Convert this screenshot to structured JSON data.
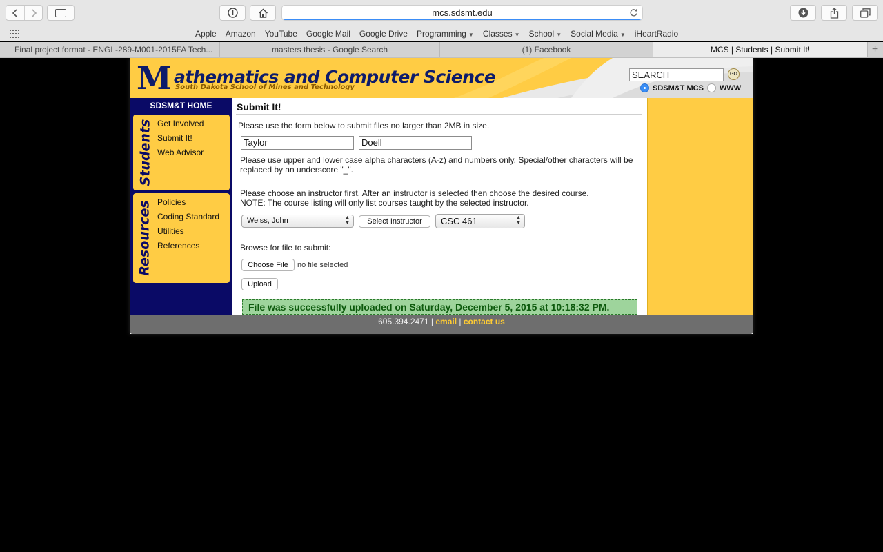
{
  "browser": {
    "url": "mcs.sdsmt.edu",
    "favorites": [
      {
        "label": "Apple",
        "menu": false
      },
      {
        "label": "Amazon",
        "menu": false
      },
      {
        "label": "YouTube",
        "menu": false
      },
      {
        "label": "Google Mail",
        "menu": false
      },
      {
        "label": "Google Drive",
        "menu": false
      },
      {
        "label": "Programming",
        "menu": true
      },
      {
        "label": "Classes",
        "menu": true
      },
      {
        "label": "School",
        "menu": true
      },
      {
        "label": "Social Media",
        "menu": true
      },
      {
        "label": "iHeartRadio",
        "menu": false
      }
    ],
    "tabs": [
      "Final project format - ENGL-289-M001-2015FA Tech...",
      "masters thesis - Google Search",
      "(1) Facebook",
      "MCS | Students | Submit It!"
    ],
    "active_tab": 3,
    "icons": {
      "back": "chevron-left-icon",
      "forward": "chevron-right-icon",
      "sidebar": "sidebar-icon",
      "privacy": "info-icon",
      "home": "home-icon",
      "reload": "reload-icon",
      "downloads": "download-icon",
      "share": "share-icon",
      "tabs": "tab-overview-icon",
      "apps": "grid-icon",
      "new_tab": "plus-icon"
    }
  },
  "site": {
    "logo_m": "M",
    "logo_text": "athematics and Computer Science",
    "logo_sub": "South Dakota School of Mines and Technology",
    "search_value": "SEARCH",
    "go_label": "GO",
    "radio_sdsmt": "SDSM&T MCS",
    "radio_www": "WWW",
    "selected_radio": "SDSM&T MCS",
    "colors": {
      "navy": "#0a0a66",
      "gold": "#ffcc44",
      "success_bg": "#9ed49c",
      "footer": "#6e6e6e"
    }
  },
  "sidebar": {
    "home": "SDSM&T HOME",
    "students_label": "Students",
    "students_links": [
      "Get Involved",
      "Submit It!",
      "Web Advisor"
    ],
    "resources_label": "Resources",
    "resources_links": [
      "Policies",
      "Coding Standard",
      "Utilities",
      "References"
    ]
  },
  "form": {
    "title": "Submit It!",
    "intro": "Please use the form below to submit files no larger than 2MB in size.",
    "first_name": "Taylor",
    "last_name": "Doell",
    "name_note": "Please use upper and lower case alpha characters (A-z) and numbers only. Special/other characters will be replaced by an underscore \"_\".",
    "instructor_note_1": "Please choose an instructor first. After an instructor is selected then choose the desired course.",
    "instructor_note_2": "NOTE: The course listing will only list courses taught by the selected instructor.",
    "instructor": "Weiss, John",
    "select_instructor_label": "Select Instructor",
    "course": "CSC 461",
    "browse_label": "Browse for file to submit:",
    "choose_file_label": "Choose File",
    "no_file": "no file selected",
    "upload_label": "Upload",
    "success_message": "File was successfully uploaded on Saturday, December 5, 2015 at 10:18:32 PM."
  },
  "footer": {
    "phone": "605.394.2471",
    "sep": "|",
    "email": "email",
    "contact": "contact us"
  }
}
